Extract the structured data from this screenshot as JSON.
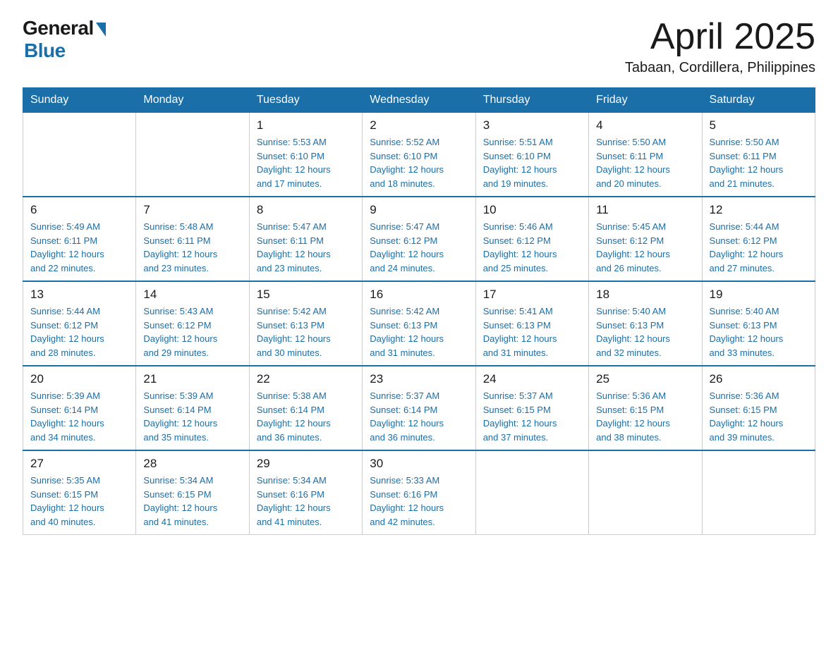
{
  "header": {
    "logo_general": "General",
    "logo_blue": "Blue",
    "title_month": "April 2025",
    "title_location": "Tabaan, Cordillera, Philippines"
  },
  "calendar": {
    "days_of_week": [
      "Sunday",
      "Monday",
      "Tuesday",
      "Wednesday",
      "Thursday",
      "Friday",
      "Saturday"
    ],
    "weeks": [
      [
        {
          "day": "",
          "info": ""
        },
        {
          "day": "",
          "info": ""
        },
        {
          "day": "1",
          "info": "Sunrise: 5:53 AM\nSunset: 6:10 PM\nDaylight: 12 hours\nand 17 minutes."
        },
        {
          "day": "2",
          "info": "Sunrise: 5:52 AM\nSunset: 6:10 PM\nDaylight: 12 hours\nand 18 minutes."
        },
        {
          "day": "3",
          "info": "Sunrise: 5:51 AM\nSunset: 6:10 PM\nDaylight: 12 hours\nand 19 minutes."
        },
        {
          "day": "4",
          "info": "Sunrise: 5:50 AM\nSunset: 6:11 PM\nDaylight: 12 hours\nand 20 minutes."
        },
        {
          "day": "5",
          "info": "Sunrise: 5:50 AM\nSunset: 6:11 PM\nDaylight: 12 hours\nand 21 minutes."
        }
      ],
      [
        {
          "day": "6",
          "info": "Sunrise: 5:49 AM\nSunset: 6:11 PM\nDaylight: 12 hours\nand 22 minutes."
        },
        {
          "day": "7",
          "info": "Sunrise: 5:48 AM\nSunset: 6:11 PM\nDaylight: 12 hours\nand 23 minutes."
        },
        {
          "day": "8",
          "info": "Sunrise: 5:47 AM\nSunset: 6:11 PM\nDaylight: 12 hours\nand 23 minutes."
        },
        {
          "day": "9",
          "info": "Sunrise: 5:47 AM\nSunset: 6:12 PM\nDaylight: 12 hours\nand 24 minutes."
        },
        {
          "day": "10",
          "info": "Sunrise: 5:46 AM\nSunset: 6:12 PM\nDaylight: 12 hours\nand 25 minutes."
        },
        {
          "day": "11",
          "info": "Sunrise: 5:45 AM\nSunset: 6:12 PM\nDaylight: 12 hours\nand 26 minutes."
        },
        {
          "day": "12",
          "info": "Sunrise: 5:44 AM\nSunset: 6:12 PM\nDaylight: 12 hours\nand 27 minutes."
        }
      ],
      [
        {
          "day": "13",
          "info": "Sunrise: 5:44 AM\nSunset: 6:12 PM\nDaylight: 12 hours\nand 28 minutes."
        },
        {
          "day": "14",
          "info": "Sunrise: 5:43 AM\nSunset: 6:12 PM\nDaylight: 12 hours\nand 29 minutes."
        },
        {
          "day": "15",
          "info": "Sunrise: 5:42 AM\nSunset: 6:13 PM\nDaylight: 12 hours\nand 30 minutes."
        },
        {
          "day": "16",
          "info": "Sunrise: 5:42 AM\nSunset: 6:13 PM\nDaylight: 12 hours\nand 31 minutes."
        },
        {
          "day": "17",
          "info": "Sunrise: 5:41 AM\nSunset: 6:13 PM\nDaylight: 12 hours\nand 31 minutes."
        },
        {
          "day": "18",
          "info": "Sunrise: 5:40 AM\nSunset: 6:13 PM\nDaylight: 12 hours\nand 32 minutes."
        },
        {
          "day": "19",
          "info": "Sunrise: 5:40 AM\nSunset: 6:13 PM\nDaylight: 12 hours\nand 33 minutes."
        }
      ],
      [
        {
          "day": "20",
          "info": "Sunrise: 5:39 AM\nSunset: 6:14 PM\nDaylight: 12 hours\nand 34 minutes."
        },
        {
          "day": "21",
          "info": "Sunrise: 5:39 AM\nSunset: 6:14 PM\nDaylight: 12 hours\nand 35 minutes."
        },
        {
          "day": "22",
          "info": "Sunrise: 5:38 AM\nSunset: 6:14 PM\nDaylight: 12 hours\nand 36 minutes."
        },
        {
          "day": "23",
          "info": "Sunrise: 5:37 AM\nSunset: 6:14 PM\nDaylight: 12 hours\nand 36 minutes."
        },
        {
          "day": "24",
          "info": "Sunrise: 5:37 AM\nSunset: 6:15 PM\nDaylight: 12 hours\nand 37 minutes."
        },
        {
          "day": "25",
          "info": "Sunrise: 5:36 AM\nSunset: 6:15 PM\nDaylight: 12 hours\nand 38 minutes."
        },
        {
          "day": "26",
          "info": "Sunrise: 5:36 AM\nSunset: 6:15 PM\nDaylight: 12 hours\nand 39 minutes."
        }
      ],
      [
        {
          "day": "27",
          "info": "Sunrise: 5:35 AM\nSunset: 6:15 PM\nDaylight: 12 hours\nand 40 minutes."
        },
        {
          "day": "28",
          "info": "Sunrise: 5:34 AM\nSunset: 6:15 PM\nDaylight: 12 hours\nand 41 minutes."
        },
        {
          "day": "29",
          "info": "Sunrise: 5:34 AM\nSunset: 6:16 PM\nDaylight: 12 hours\nand 41 minutes."
        },
        {
          "day": "30",
          "info": "Sunrise: 5:33 AM\nSunset: 6:16 PM\nDaylight: 12 hours\nand 42 minutes."
        },
        {
          "day": "",
          "info": ""
        },
        {
          "day": "",
          "info": ""
        },
        {
          "day": "",
          "info": ""
        }
      ]
    ]
  }
}
